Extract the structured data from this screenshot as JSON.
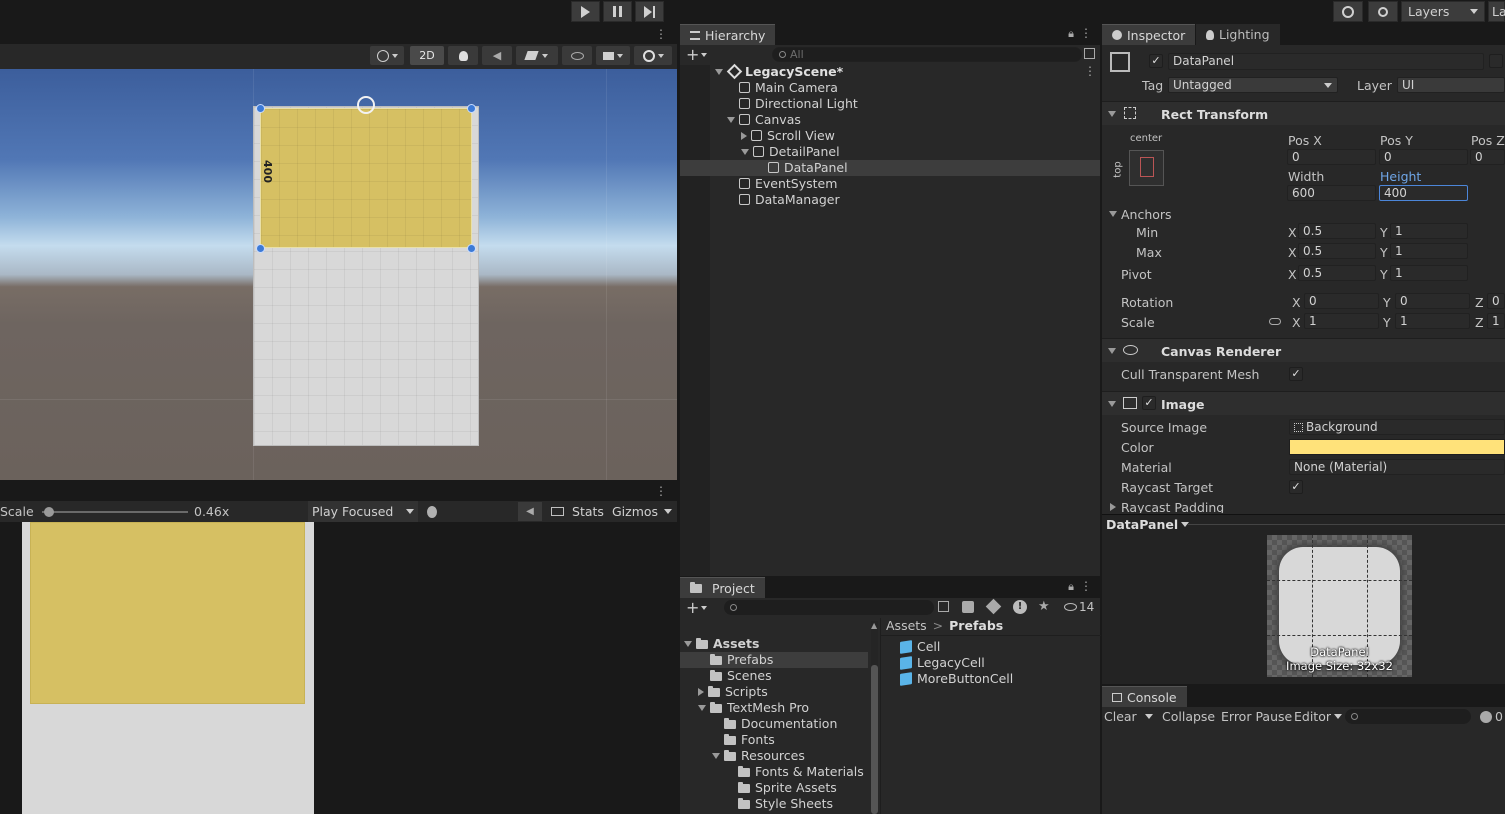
{
  "top_toolbar": {
    "play_icon": "play-icon",
    "pause_icon": "pause-icon",
    "step_icon": "step-icon",
    "layers_label": "Layers",
    "layout_label": "La"
  },
  "scene_view": {
    "toolbar": {
      "mode_2d_label": "2D"
    },
    "height_handle_label": "400"
  },
  "game_view": {
    "scale_label": "Scale",
    "scale_value": "0.46x",
    "scale_level": 0.04,
    "play_mode_label": "Play Focused",
    "stats_label": "Stats",
    "gizmos_label": "Gizmos"
  },
  "hierarchy": {
    "tab_label": "Hierarchy",
    "search_placeholder": "All",
    "scene_name": "LegacyScene*",
    "items": [
      {
        "label": "Main Camera"
      },
      {
        "label": "Directional Light"
      },
      {
        "label": "Canvas"
      },
      {
        "label": "Scroll View"
      },
      {
        "label": "DetailPanel"
      },
      {
        "label": "DataPanel"
      },
      {
        "label": "EventSystem"
      },
      {
        "label": "DataManager"
      }
    ]
  },
  "project": {
    "tab_label": "Project",
    "hidden_count": "14",
    "tree": [
      {
        "label": "Assets"
      },
      {
        "label": "Prefabs"
      },
      {
        "label": "Scenes"
      },
      {
        "label": "Scripts"
      },
      {
        "label": "TextMesh Pro"
      },
      {
        "label": "Documentation"
      },
      {
        "label": "Fonts"
      },
      {
        "label": "Resources"
      },
      {
        "label": "Fonts & Materials"
      },
      {
        "label": "Sprite Assets"
      },
      {
        "label": "Style Sheets"
      }
    ],
    "breadcrumb": {
      "root": "Assets",
      "sep": ">",
      "current": "Prefabs"
    },
    "files": [
      {
        "label": "Cell"
      },
      {
        "label": "LegacyCell"
      },
      {
        "label": "MoreButtonCell"
      }
    ]
  },
  "inspector": {
    "tab_label": "Inspector",
    "lighting_tab_label": "Lighting",
    "object_name": "DataPanel",
    "tag_label": "Tag",
    "tag_value": "Untagged",
    "layer_label": "Layer",
    "layer_value": "UI",
    "rect_transform": {
      "title": "Rect Transform",
      "anchor_preset_h": "center",
      "anchor_preset_v": "top",
      "pos_x_label": "Pos X",
      "pos_y_label": "Pos Y",
      "pos_z_label": "Pos Z",
      "pos_x": "0",
      "pos_y": "0",
      "pos_z": "0",
      "width_label": "Width",
      "height_label": "Height",
      "width": "600",
      "height": "400",
      "anchors_label": "Anchors",
      "min_label": "Min",
      "max_label": "Max",
      "pivot_label": "Pivot",
      "rotation_label": "Rotation",
      "scale_label": "Scale",
      "x": "X",
      "y": "Y",
      "z": "Z",
      "anchor_min_x": "0.5",
      "anchor_min_y": "1",
      "anchor_max_x": "0.5",
      "anchor_max_y": "1",
      "pivot_x": "0.5",
      "pivot_y": "1",
      "rot_x": "0",
      "rot_y": "0",
      "rot_z": "0",
      "scale_x": "1",
      "scale_y": "1",
      "scale_z": "1"
    },
    "canvas_renderer": {
      "title": "Canvas Renderer",
      "cull_label": "Cull Transparent Mesh"
    },
    "image": {
      "title": "Image",
      "source_image_label": "Source Image",
      "source_image_value": "Background",
      "color_label": "Color",
      "color_value": "#ffe27a",
      "material_label": "Material",
      "material_value": "None (Material)",
      "raycast_target_label": "Raycast Target",
      "raycast_padding_label": "Raycast Padding"
    },
    "preview": {
      "title": "DataPanel",
      "name": "DataPanel",
      "size_text": "Image Size: 32x32"
    }
  },
  "console": {
    "tab_label": "Console",
    "clear_label": "Clear",
    "collapse_label": "Collapse",
    "error_pause_label": "Error Pause",
    "editor_label": "Editor",
    "count": "0"
  },
  "colors": {
    "panel_yellow": "#d6c063",
    "selection_blue": "#3b6ea5",
    "accent_blue": "#4c86d9"
  }
}
